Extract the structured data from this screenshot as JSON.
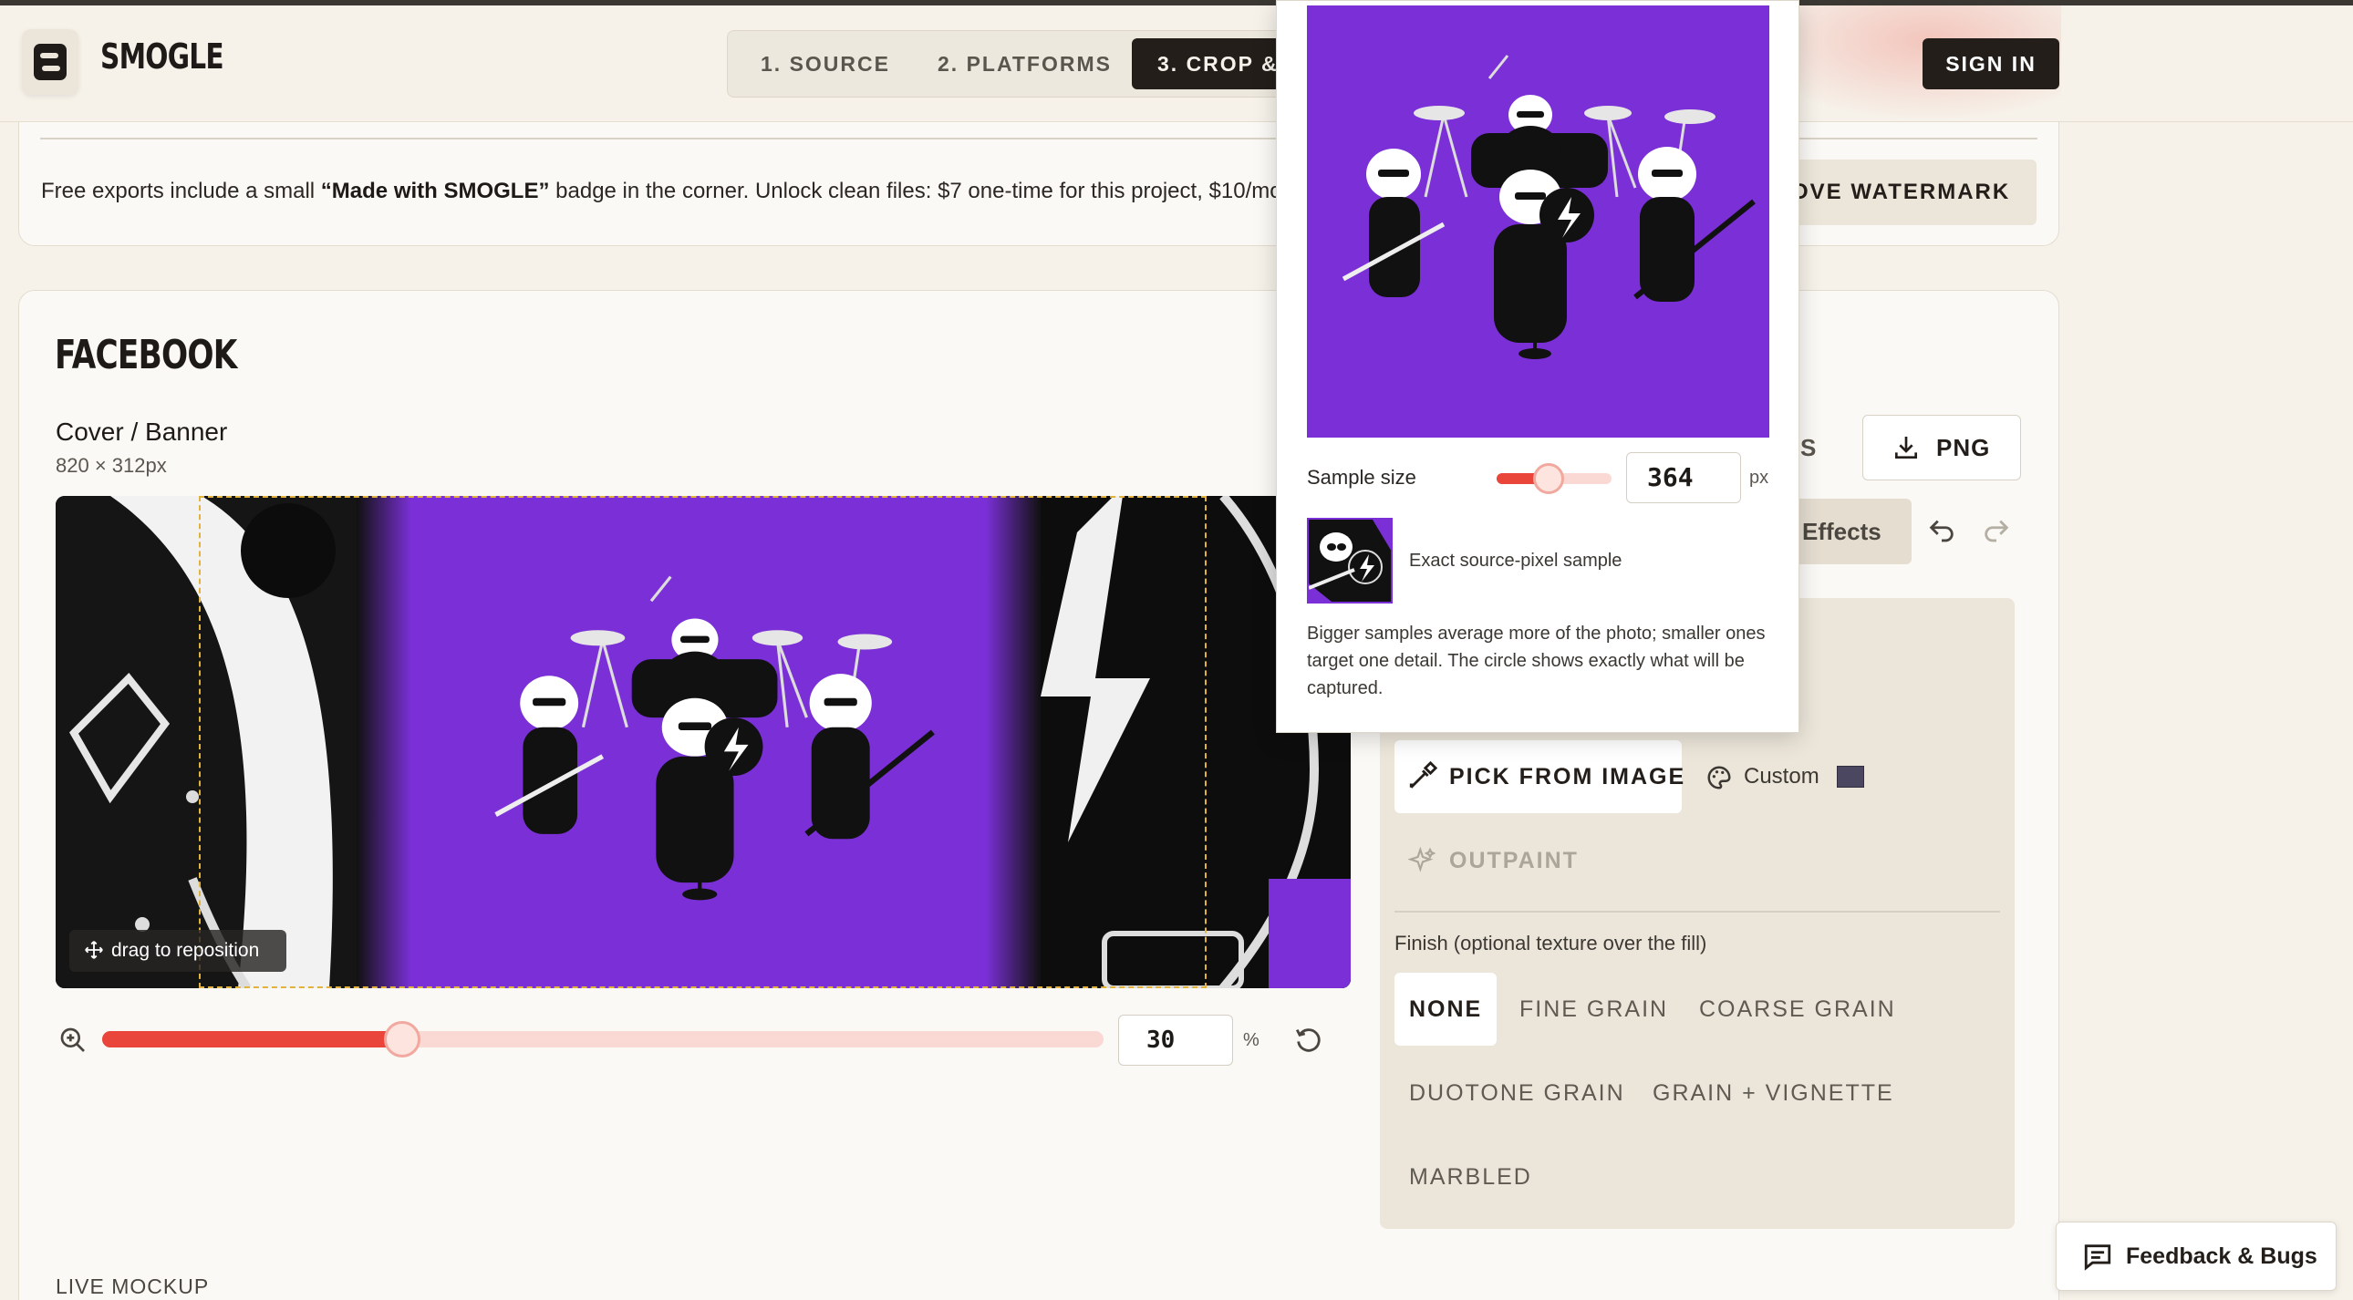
{
  "header": {
    "brand": "SMOGLE",
    "steps": [
      {
        "label": "1. SOURCE"
      },
      {
        "label": "2. PLATFORMS"
      },
      {
        "label": "3. CROP &"
      }
    ],
    "sign_in": "SIGN IN"
  },
  "watermark": {
    "text_prefix": "Free exports include a small ",
    "text_bold": "“Made with SMOGLE”",
    "text_suffix": " badge in the corner. Unlock clean files: $7 one-time for this project, $10/mo,",
    "button": "OVE WATERMARK"
  },
  "platform": {
    "title": "FACEBOOK",
    "format_name": "Cover / Banner",
    "format_size": "820 × 312px",
    "drag_hint": "drag to reposition",
    "zoom_value": "30",
    "zoom_percent_fraction": 0.3,
    "zoom_unit": "%",
    "live_mockup": "LIVE MOCKUP"
  },
  "toolbar": {
    "tab_fragment": "S",
    "png_button": "PNG",
    "effects_tab": "Effects"
  },
  "background_panel": {
    "pick_button": "PICK FROM IMAGE",
    "custom_label": "Custom",
    "custom_color": "#4b4760",
    "outpaint": "OUTPAINT",
    "finish_label": "Finish (optional texture over the fill)",
    "finishes": [
      "NONE",
      "FINE GRAIN",
      "COARSE GRAIN",
      "DUOTONE GRAIN",
      "GRAIN + VIGNETTE",
      "MARBLED"
    ],
    "selected_finish": "NONE"
  },
  "sampler": {
    "sample_size_label": "Sample size",
    "sample_size_value": "364",
    "sample_size_unit": "px",
    "sample_caption": "Exact source-pixel sample",
    "help_text": "Bigger samples average more of the photo; smaller ones target one detail. The circle shows exactly what will be captured."
  },
  "feedback": {
    "label": "Feedback & Bugs"
  },
  "colors": {
    "accent": "#e9453a",
    "dark": "#231e1a",
    "image_purple": "#7a30d6",
    "background": "#f6f2ea",
    "crop_outline": "#e2b33c"
  },
  "icons": [
    "zoom-in-icon",
    "reset-icon",
    "move-icon",
    "download-icon",
    "undo-icon",
    "redo-icon",
    "eyedropper-icon",
    "palette-icon",
    "sparkles-icon",
    "chat-icon"
  ]
}
